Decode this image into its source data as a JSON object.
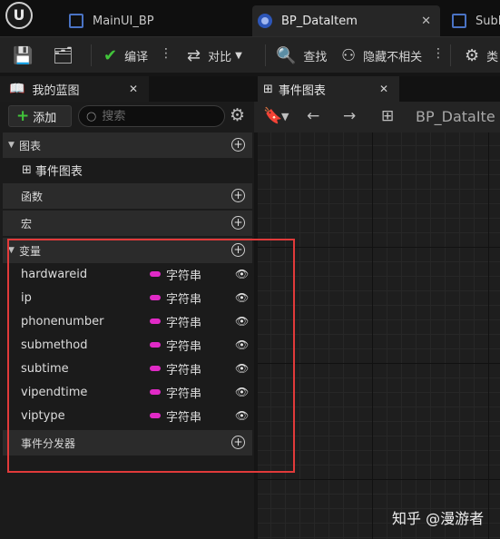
{
  "tabs": [
    {
      "label": "MainUI_BP"
    },
    {
      "label": "BP_DataItem"
    },
    {
      "label": "SubL"
    }
  ],
  "toolbar": {
    "compile_label": "编译",
    "diff_label": "对比",
    "find_label": "查找",
    "hide_label": "隐藏不相关",
    "class_label": "类"
  },
  "panel": {
    "title": "我的蓝图",
    "add_label": "添加",
    "search_placeholder": "搜索",
    "sections": {
      "graphs": "图表",
      "functions": "函数",
      "macros": "宏",
      "variables": "变量",
      "dispatchers": "事件分发器"
    },
    "event_graph_item": "事件图表",
    "variables": [
      {
        "name": "hardwareid",
        "type": "字符串"
      },
      {
        "name": "ip",
        "type": "字符串"
      },
      {
        "name": "phonenumber",
        "type": "字符串"
      },
      {
        "name": "submethod",
        "type": "字符串"
      },
      {
        "name": "subtime",
        "type": "字符串"
      },
      {
        "name": "vipendtime",
        "type": "字符串"
      },
      {
        "name": "viptype",
        "type": "字符串"
      }
    ]
  },
  "graph": {
    "tab_label": "事件图表",
    "breadcrumb": "BP_DataIte"
  },
  "watermark": "知乎 @漫游者",
  "colors": {
    "string_pin": "#e02ac6",
    "highlight_box": "#e13a3a",
    "add_plus": "#41c43a"
  }
}
